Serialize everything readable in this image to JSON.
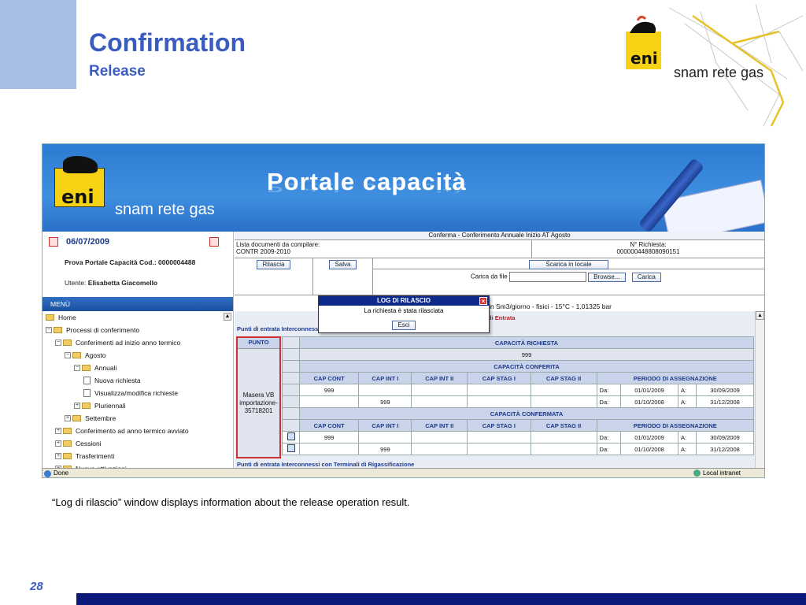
{
  "slide": {
    "title": "Confirmation",
    "subtitle": "Release",
    "caption": "“Log di rilascio” window displays information about the release operation result.",
    "page_number": "28",
    "logo_brand": "snam rete gas",
    "logo_eni": "eni"
  },
  "portal": {
    "banner_title": "Portale capacità",
    "brand": "snam rete gas",
    "eni": "eni",
    "date": "06/07/2009",
    "company_label": "Prova Portale Capacità Cod.:",
    "company_code": "0000004488",
    "user_label": "Utente:",
    "user_name": "Elisabetta Giacomello",
    "menu_label": "MENÙ",
    "tree": [
      {
        "label": "Home",
        "type": "folder",
        "indent": 0,
        "pm": ""
      },
      {
        "label": "Processi di conferimento",
        "type": "folder",
        "indent": 0,
        "pm": "−"
      },
      {
        "label": "Conferimenti ad inizio anno termico",
        "type": "folder",
        "indent": 1,
        "pm": "−"
      },
      {
        "label": "Agosto",
        "type": "folder",
        "indent": 2,
        "pm": "−"
      },
      {
        "label": "Annuali",
        "type": "folder",
        "indent": 3,
        "pm": "−"
      },
      {
        "label": "Nuova richiesta",
        "type": "doc",
        "indent": 4,
        "pm": ""
      },
      {
        "label": "Visualizza/modifica richieste",
        "type": "doc",
        "indent": 4,
        "pm": ""
      },
      {
        "label": "Pluriennali",
        "type": "folder",
        "indent": 3,
        "pm": "+"
      },
      {
        "label": "Settembre",
        "type": "folder",
        "indent": 2,
        "pm": "+"
      },
      {
        "label": "Conferimento ad anno termico avviato",
        "type": "folder",
        "indent": 1,
        "pm": "+"
      },
      {
        "label": "Cessioni",
        "type": "folder",
        "indent": 1,
        "pm": "+"
      },
      {
        "label": "Trasferimenti",
        "type": "folder",
        "indent": 1,
        "pm": "+"
      },
      {
        "label": "Nuove attivazioni",
        "type": "folder",
        "indent": 1,
        "pm": "+"
      }
    ],
    "header_title": "Conferma - Conferimento Annuale Inizio AT Agosto",
    "doc_list_label": "Lista documenti da compilare:",
    "doc_list_value": "CONTR 2009-2010",
    "request_label": "N° Richiesta:",
    "request_value": "000000448808090151",
    "btn_rilascia": "Rilascia",
    "btn_salva": "Salva",
    "btn_scarica": "Scarica in locale",
    "load_label": "Carica da file",
    "btn_browse": "Browse...",
    "btn_carica": "Carica",
    "units_line": "in Sm3/giorno - fisici - 15°C - 1,01325 bar",
    "section1": "Punti di entrata Interconnessi",
    "section1_tail": "di Entrata",
    "section2": "Punti di entrata Interconnessi con Terminali di Rigassificazione",
    "punto_header": "PUNTO",
    "punto_value": "Masera VB importazione-35718201",
    "cap_richiesta": "CAPACITÀ RICHIESTA",
    "cap_richiesta_value": "999",
    "cap_conferita": "CAPACITÀ CONFERITA",
    "cap_confermata": "CAPACITÀ CONFERMATA",
    "cols": [
      "CAP CONT",
      "CAP INT I",
      "CAP INT II",
      "CAP STAG I",
      "CAP STAG II"
    ],
    "periodo": "PERIODO DI ASSEGNAZIONE",
    "da": "Da:",
    "a": "A:",
    "conferita_rows": [
      {
        "cont": "999",
        "int1": "",
        "from": "01/01/2009",
        "to": "30/09/2009"
      },
      {
        "cont": "",
        "int1": "999",
        "from": "01/10/2008",
        "to": "31/12/2008"
      }
    ],
    "confermata_rows": [
      {
        "cont": "999",
        "int1": "",
        "from": "01/01/2009",
        "to": "30/09/2009"
      },
      {
        "cont": "",
        "int1": "999",
        "from": "01/10/2008",
        "to": "31/12/2008"
      }
    ],
    "status_done": "Done",
    "status_zone": "Local intranet"
  },
  "dialog": {
    "title": "LOG DI RILASCIO",
    "message": "La richiesta è stata rilasciata",
    "button": "Esci",
    "close": "×"
  }
}
